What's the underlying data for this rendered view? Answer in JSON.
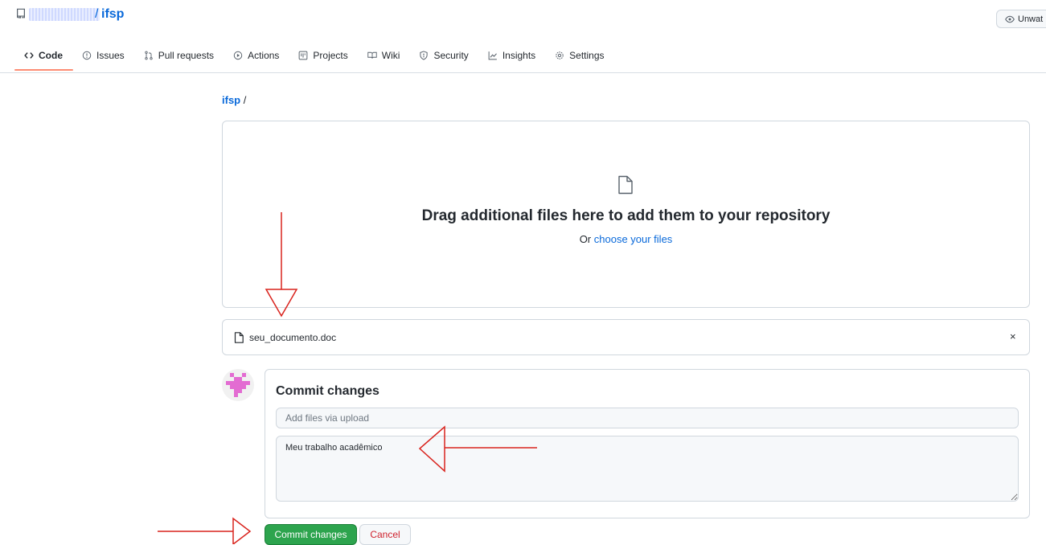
{
  "repo": {
    "name": "ifsp",
    "separator": "/",
    "watch_label": "Unwat"
  },
  "tabs": [
    {
      "label": "Code",
      "icon": "code-icon",
      "active": true
    },
    {
      "label": "Issues",
      "icon": "issue-icon"
    },
    {
      "label": "Pull requests",
      "icon": "pull-request-icon"
    },
    {
      "label": "Actions",
      "icon": "play-icon"
    },
    {
      "label": "Projects",
      "icon": "project-icon"
    },
    {
      "label": "Wiki",
      "icon": "book-icon"
    },
    {
      "label": "Security",
      "icon": "shield-icon"
    },
    {
      "label": "Insights",
      "icon": "graph-icon"
    },
    {
      "label": "Settings",
      "icon": "gear-icon"
    }
  ],
  "breadcrumb": {
    "repo": "ifsp",
    "sep": "/"
  },
  "dropzone": {
    "title": "Drag additional files here to add them to your repository",
    "prefix": "Or ",
    "link": "choose your files"
  },
  "file": {
    "name": "seu_documento.doc",
    "remove": "×"
  },
  "commit": {
    "title": "Commit changes",
    "summary_placeholder": "Add files via upload",
    "description": "Meu trabalho acadêmico",
    "commit_button": "Commit changes",
    "cancel_button": "Cancel"
  },
  "colors": {
    "link": "#0969da",
    "primary_button": "#2da44e",
    "cancel_text": "#cf222e",
    "annotation_arrow": "#d9221c",
    "avatar_pixels": "#e36cd2"
  }
}
